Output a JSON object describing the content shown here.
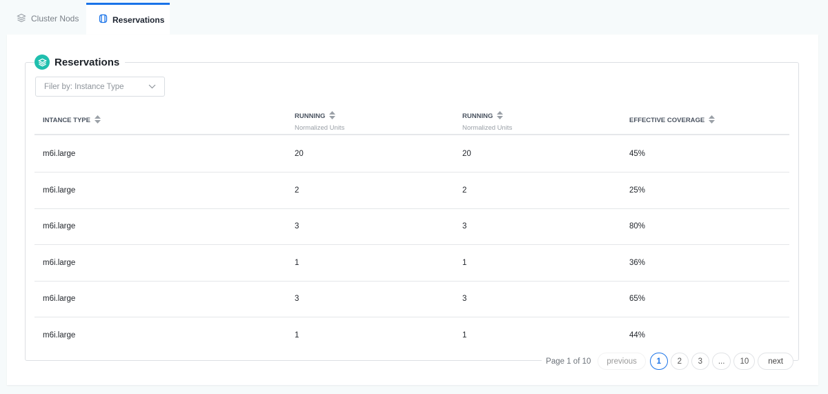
{
  "tabs": [
    {
      "label": "Cluster Nods",
      "icon": "layers-icon",
      "active": false
    },
    {
      "label": "Reservations",
      "icon": "reservation-icon",
      "active": true
    }
  ],
  "section": {
    "title": "Reservations",
    "icon": "layers-icon",
    "accent": "#1fbfae"
  },
  "filter": {
    "placeholder": "Filer by: Instance Type"
  },
  "table": {
    "columns": [
      {
        "label": "INTANCE TYPE",
        "sub": ""
      },
      {
        "label": "RUNNING",
        "sub": "Normalized Units"
      },
      {
        "label": "RUNNING",
        "sub": "Normalized Units"
      },
      {
        "label": "EFFECTIVE COVERAGE",
        "sub": ""
      }
    ],
    "rows": [
      [
        "m6i.large",
        "20",
        "20",
        "45%"
      ],
      [
        "m6i.large",
        "2",
        "2",
        "25%"
      ],
      [
        "m6i.large",
        "3",
        "3",
        "80%"
      ],
      [
        "m6i.large",
        "1",
        "1",
        "36%"
      ],
      [
        "m6i.large",
        "3",
        "3",
        "65%"
      ],
      [
        "m6i.large",
        "1",
        "1",
        "44%"
      ]
    ]
  },
  "pagination": {
    "status": "Page 1 of 10",
    "previous": "previous",
    "next": "next",
    "pages": [
      "1",
      "2",
      "3",
      "...",
      "10"
    ],
    "current": "1"
  },
  "colors": {
    "active_tab": "#1a73e8"
  }
}
